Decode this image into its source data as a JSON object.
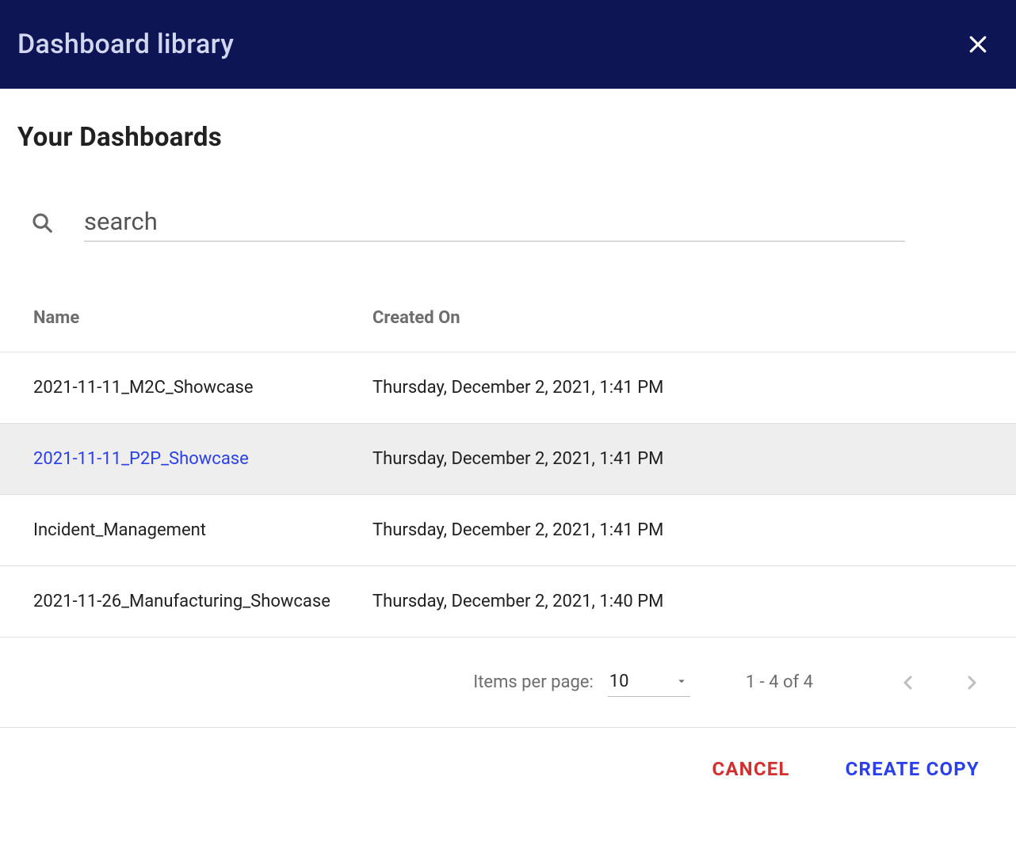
{
  "header": {
    "title": "Dashboard library"
  },
  "section": {
    "title": "Your Dashboards"
  },
  "search": {
    "placeholder": "search",
    "value": ""
  },
  "table": {
    "columns": {
      "name": "Name",
      "created_on": "Created On"
    },
    "rows": [
      {
        "name": "2021-11-11_M2C_Showcase",
        "created_on": "Thursday, December 2, 2021, 1:41 PM",
        "selected": false
      },
      {
        "name": "2021-11-11_P2P_Showcase",
        "created_on": "Thursday, December 2, 2021, 1:41 PM",
        "selected": true
      },
      {
        "name": "Incident_Management",
        "created_on": "Thursday, December 2, 2021, 1:41 PM",
        "selected": false
      },
      {
        "name": "2021-11-26_Manufacturing_Showcase",
        "created_on": "Thursday, December 2, 2021, 1:40 PM",
        "selected": false
      }
    ]
  },
  "paginator": {
    "items_per_page_label": "Items per page:",
    "page_size": "10",
    "range_label": "1 - 4 of 4"
  },
  "footer": {
    "cancel": "CANCEL",
    "create_copy": "CREATE COPY"
  }
}
